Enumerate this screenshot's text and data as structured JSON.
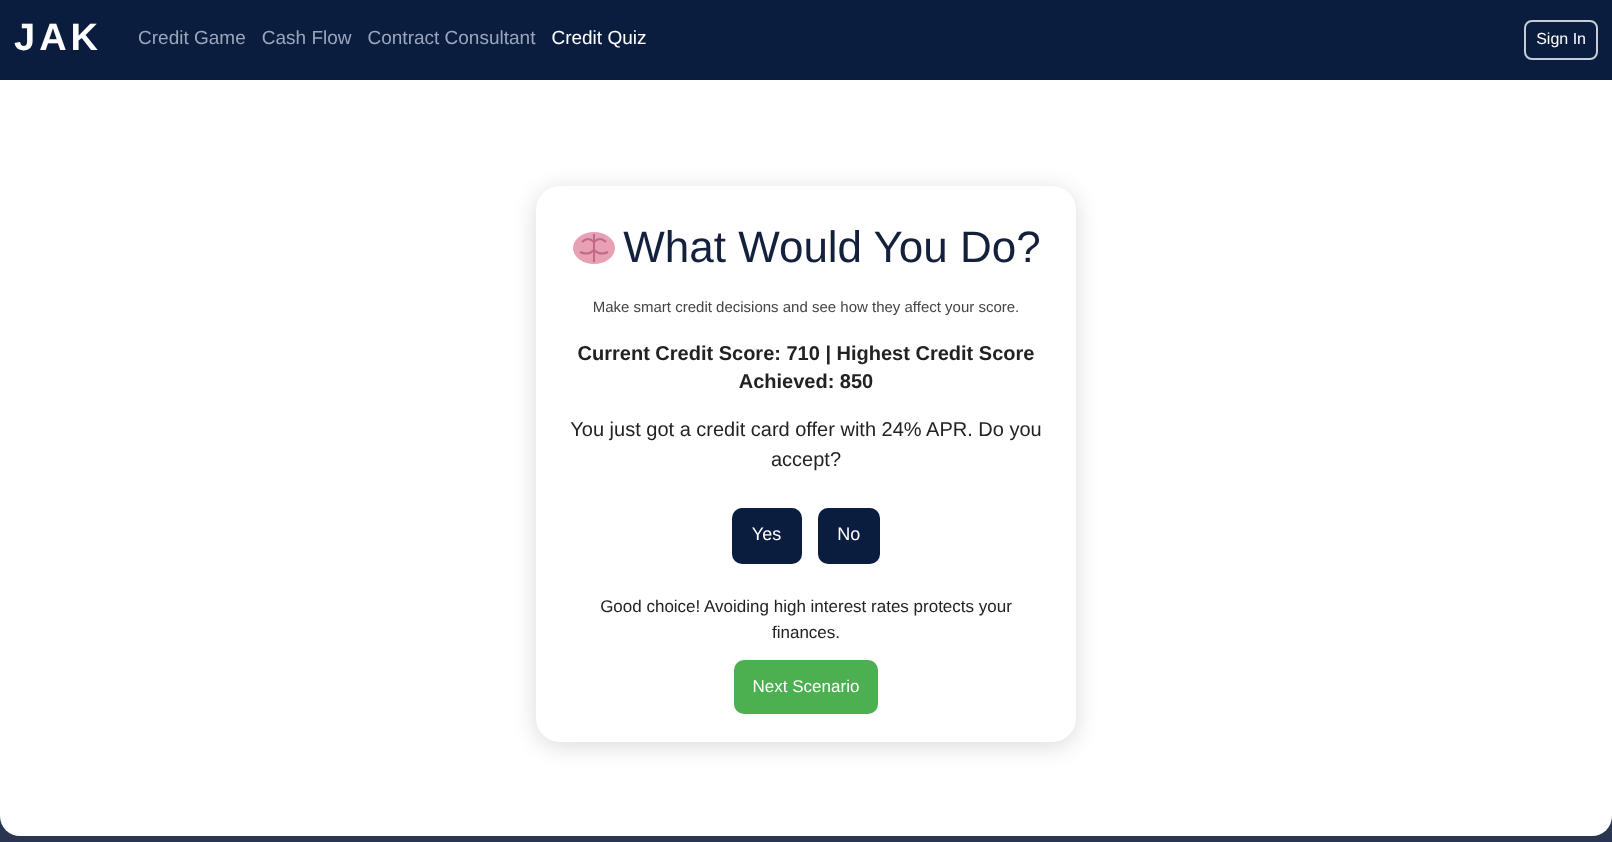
{
  "navbar": {
    "brand": "JAK",
    "links": [
      {
        "label": "Credit Game",
        "selected": false
      },
      {
        "label": "Cash Flow",
        "selected": false
      },
      {
        "label": "Contract Consultant",
        "selected": false
      },
      {
        "label": "Credit Quiz",
        "selected": true
      }
    ],
    "sign_in": "Sign In"
  },
  "quiz": {
    "title": "What Would You Do?",
    "subtitle": "Make smart credit decisions and see how they affect your score.",
    "score": "Current Credit Score: 710 | Highest Credit Score Achieved: 850",
    "question": "You just got a credit card offer with 24% APR. Do you accept?",
    "answers": [
      "Yes",
      "No"
    ],
    "feedback": "Good choice! Avoiding high interest rates protects your finances.",
    "next": "Next Scenario"
  }
}
